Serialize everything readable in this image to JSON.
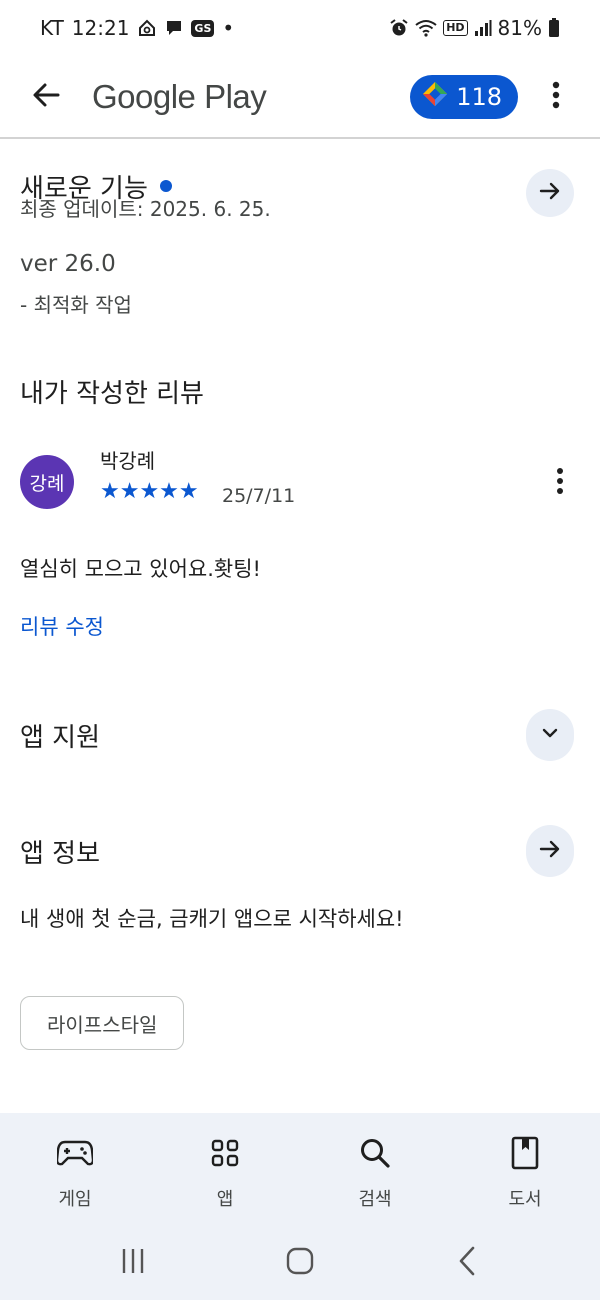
{
  "status_bar": {
    "carrier": "KT",
    "time": "12:21",
    "gs_badge": "GS",
    "dot": "•",
    "battery": "81%",
    "hd_label": "HD"
  },
  "app_bar": {
    "title": "Google Play",
    "points": "118"
  },
  "whats_new": {
    "title": "새로운 기능",
    "last_updated": "최종 업데이트: 2025. 6. 25.",
    "version": "ver 26.0",
    "notes": "- 최적화 작업"
  },
  "my_review": {
    "title": "내가 작성한 리뷰",
    "avatar_text": "강례",
    "reviewer_name": "박강례",
    "rating": 5,
    "stars": "★★★★★",
    "date": "25/7/11",
    "body": "열심히 모으고 있어요.홧팅!",
    "edit_label": "리뷰 수정"
  },
  "app_support": {
    "title": "앱 지원"
  },
  "app_info": {
    "title": "앱 정보",
    "description": "내 생애 첫 순금, 금캐기 앱으로 시작하세요!",
    "category_chip": "라이프스타일"
  },
  "bottom_nav": {
    "items": [
      {
        "label": "게임",
        "icon": "gamepad-icon"
      },
      {
        "label": "앱",
        "icon": "apps-grid-icon"
      },
      {
        "label": "검색",
        "icon": "search-icon"
      },
      {
        "label": "도서",
        "icon": "book-icon"
      }
    ]
  },
  "colors": {
    "accent": "#0b57d0",
    "avatar": "#5b35b3",
    "nav_background": "#eef2f8",
    "circle_button": "#e9eef6"
  }
}
